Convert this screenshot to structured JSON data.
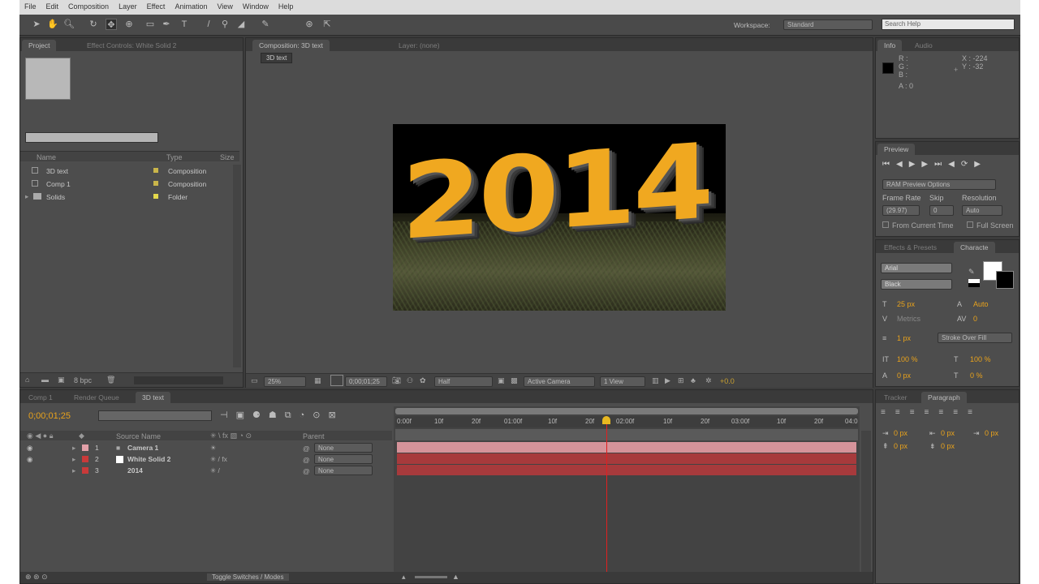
{
  "menubar": {
    "items": [
      "File",
      "Edit",
      "Composition",
      "Layer",
      "Effect",
      "Animation",
      "View",
      "Window",
      "Help"
    ]
  },
  "toolbar": {
    "workspace_label": "Workspace:",
    "workspace_value": "Standard",
    "search_placeholder": "Search Help"
  },
  "project_panel": {
    "tabs": [
      "Project",
      "Effect Controls: White Solid 2"
    ],
    "search_placeholder": "",
    "columns": [
      "Name",
      "Type",
      "Size"
    ],
    "items": [
      {
        "name": "3D text",
        "type": "Composition",
        "label_color": "#c9b54a"
      },
      {
        "name": "Comp 1",
        "type": "Composition",
        "label_color": "#c9b54a"
      },
      {
        "name": "Solids",
        "type": "Folder",
        "label_color": "#e3d84c"
      }
    ],
    "bpc": "8 bpc"
  },
  "comp_panel": {
    "tabs": [
      "Composition: 3D text",
      "Layer: (none)"
    ],
    "breadcrumb": "3D text",
    "preview_text": "2014",
    "zoom": "25%",
    "timecode": "0;00;01;25",
    "resolution": "Half",
    "camera": "Active Camera",
    "views": "1 View",
    "exposure": "+0.0"
  },
  "info_panel": {
    "tabs": [
      "Info",
      "Audio"
    ],
    "r": "R :",
    "g": "G :",
    "b": "B :",
    "a": "A : 0",
    "x": "X : -224",
    "y": "Y : -32"
  },
  "preview_panel": {
    "title": "Preview",
    "ram_options": "RAM Preview Options",
    "frame_rate_label": "Frame Rate",
    "skip_label": "Skip",
    "resolution_label": "Resolution",
    "frame_rate": "(29.97)",
    "skip": "0",
    "resolution": "Auto",
    "from_current": "From Current Time",
    "full_screen": "Full Screen"
  },
  "character_panel": {
    "tabs": [
      "Effects & Presets",
      "Characte"
    ],
    "font": "Arial",
    "style": "Black",
    "size": "25 px",
    "leading": "Auto",
    "tracking": "0",
    "kerning": "Metrics",
    "stroke": "1 px",
    "stroke_type": "Stroke Over Fill",
    "vscale": "100 %",
    "hscale": "100 %",
    "baseline": "0 px",
    "tsume": "0 %"
  },
  "paragraph_panel": {
    "tabs": [
      "Tracker",
      "Paragraph"
    ],
    "values": [
      "0 px",
      "0 px",
      "0 px",
      "0 px",
      "0 px"
    ]
  },
  "timeline": {
    "tabs": [
      "Comp 1",
      "Render Queue",
      "3D text"
    ],
    "timecode": "0;00;01;25",
    "columns": {
      "name": "Source Name",
      "parent": "Parent"
    },
    "ruler": [
      "0:00f",
      "10f",
      "20f",
      "01:00f",
      "10f",
      "20f",
      "02:00f",
      "10f",
      "20f",
      "03:00f",
      "10f",
      "20f",
      "04:0"
    ],
    "layers": [
      {
        "num": "1",
        "name": "Camera 1",
        "label_color": "#e2a0a8",
        "parent": "None",
        "bar_color": "#d5939a"
      },
      {
        "num": "2",
        "name": "White Solid 2",
        "label_color": "#c93a3a",
        "parent": "None",
        "bar_color": "#a73a3c"
      },
      {
        "num": "3",
        "name": "2014",
        "label_color": "#c93a3a",
        "parent": "None",
        "bar_color": "#a73a3c"
      }
    ],
    "toggle_label": "Toggle Switches / Modes"
  }
}
